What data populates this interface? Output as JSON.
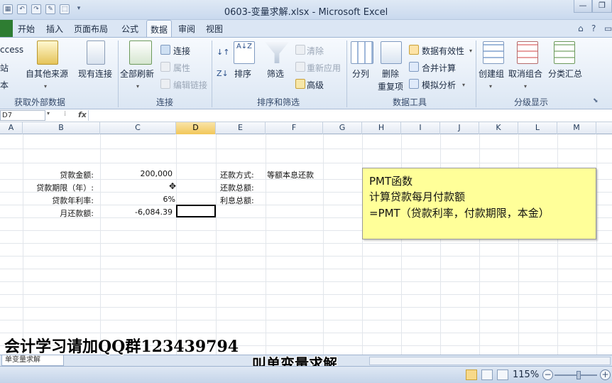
{
  "window": {
    "title": "0603-变量求解.xlsx - Microsoft Excel"
  },
  "tabs": [
    {
      "label": "开始",
      "active": false
    },
    {
      "label": "插入",
      "active": false
    },
    {
      "label": "页面布局",
      "active": false
    },
    {
      "label": "公式",
      "active": false
    },
    {
      "label": "数据",
      "active": true
    },
    {
      "label": "审阅",
      "active": false
    },
    {
      "label": "视图",
      "active": false
    }
  ],
  "ribbon": {
    "external": {
      "access": "ccess",
      "web": "站",
      "text": "本",
      "other_sources": "自其他来源",
      "existing": "现有连接",
      "group": "获取外部数据"
    },
    "connections": {
      "refresh_all": "全部刷新",
      "connections": "连接",
      "properties": "属性",
      "edit_links": "编辑链接",
      "group": "连接"
    },
    "sort_filter": {
      "sort_az": "A↓Z",
      "sort": "排序",
      "filter": "筛选",
      "clear": "清除",
      "reapply": "重新应用",
      "advanced": "高级",
      "group": "排序和筛选"
    },
    "data_tools": {
      "split": "分列",
      "remove": "删除",
      "duplicates": "重复项",
      "validation": "数据有效性",
      "consolidate": "合并计算",
      "whatif": "模拟分析",
      "group": "数据工具"
    },
    "outline": {
      "group_btn": "创建组",
      "ungroup": "取消组合",
      "subtotal": "分类汇总",
      "group": "分级显示"
    }
  },
  "formula_bar": {
    "name_box": "D7",
    "fx": "fx",
    "content": ""
  },
  "columns": [
    "A",
    "B",
    "C",
    "D",
    "E",
    "F",
    "G",
    "H",
    "I",
    "J",
    "K",
    "L",
    "M"
  ],
  "selected_column": "D",
  "cells": {
    "b1": "贷款金额:",
    "c1": "200,000",
    "b2": "贷款期限（年）:",
    "b3": "贷款年利率:",
    "c3": "6%",
    "b4": "月还款额:",
    "c4": "-6,084.39",
    "e1": "还款方式:",
    "f1": "等额本息还款",
    "e2": "还款总额:",
    "e3": "利息总额:"
  },
  "note": {
    "line1": "PMT函数",
    "line2": "计算贷款每月付款额",
    "line3": "=PMT（贷款利率，付款期限，本金）"
  },
  "overlay": {
    "watermark": "会计学习请加QQ群123439794",
    "subtitle": "叫单变量求解"
  },
  "sheet_tab": "单变量求解",
  "status": {
    "zoom": "115%"
  },
  "colors": {
    "note_bg": "#ffff99",
    "active_tab_bg": "#f4f8fd",
    "ribbon_bg": "#dbe6f3",
    "selected_col": "#f2c75a"
  }
}
